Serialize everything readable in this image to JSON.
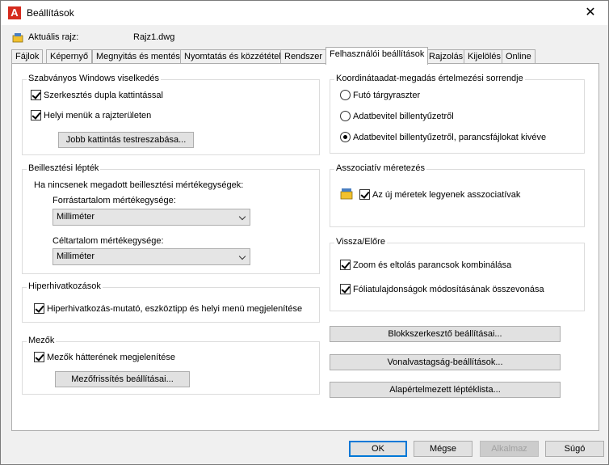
{
  "window": {
    "title": "Beállítások",
    "app_icon": "A",
    "close": "✕"
  },
  "drawing": {
    "label": "Aktuális rajz:",
    "value": "Rajz1.dwg"
  },
  "tabs": [
    {
      "label": "Fájlok"
    },
    {
      "label": "Képernyő"
    },
    {
      "label": "Megnyitás és mentés"
    },
    {
      "label": "Nyomtatás és közzététel"
    },
    {
      "label": "Rendszer"
    },
    {
      "label": "Felhasználói beállítások"
    },
    {
      "label": "Rajzolás"
    },
    {
      "label": "Kijelölés"
    },
    {
      "label": "Online"
    }
  ],
  "windows_behavior": {
    "title": "Szabványos Windows viselkedés",
    "double_click_edit": "Szerkesztés dupla kattintással",
    "shortcut_menus": "Helyi menük a rajzterületen",
    "right_click_button": "Jobb kattintás testreszabása..."
  },
  "insert_scale": {
    "title": "Beillesztési lépték",
    "desc": "Ha nincsenek megadott beillesztési mértékegységek:",
    "source_label": "Forrástartalom mértékegysége:",
    "source_value": "Milliméter",
    "target_label": "Céltartalom mértékegysége:",
    "target_value": "Milliméter"
  },
  "hyperlinks": {
    "title": "Hiperhivatkozások",
    "display": "Hiperhivatkozás-mutató, eszköztipp és helyi menü megjelenítése"
  },
  "fields": {
    "title": "Mezők",
    "display_bg": "Mezők hátterének megjelenítése",
    "update_button": "Mezőfrissítés beállításai..."
  },
  "coord_priority": {
    "title": "Koordinátaadat-megadás értelmezési sorrendje",
    "options": [
      {
        "label": "Futó tárgyraszter",
        "selected": false
      },
      {
        "label": "Adatbevitel billentyűzetről",
        "selected": false
      },
      {
        "label": "Adatbevitel billentyűzetről, parancsfájlokat kivéve",
        "selected": true
      }
    ]
  },
  "assoc_dim": {
    "title": "Asszociatív méretezés",
    "make_assoc": "Az új méretek legyenek asszociatívak"
  },
  "undo_redo": {
    "title": "Vissza/Előre",
    "combine_zoom": "Zoom és eltolás parancsok kombinálása",
    "combine_layer": "Fóliatulajdonságok módosításának összevonása"
  },
  "side_buttons": {
    "block_editor": "Blokkszerkesztő beállításai...",
    "lineweight": "Vonalvastagság-beállítások...",
    "scale_list": "Alapértelmezett léptéklista..."
  },
  "footer": {
    "ok": "OK",
    "cancel": "Mégse",
    "apply": "Alkalmaz",
    "help": "Súgó"
  }
}
